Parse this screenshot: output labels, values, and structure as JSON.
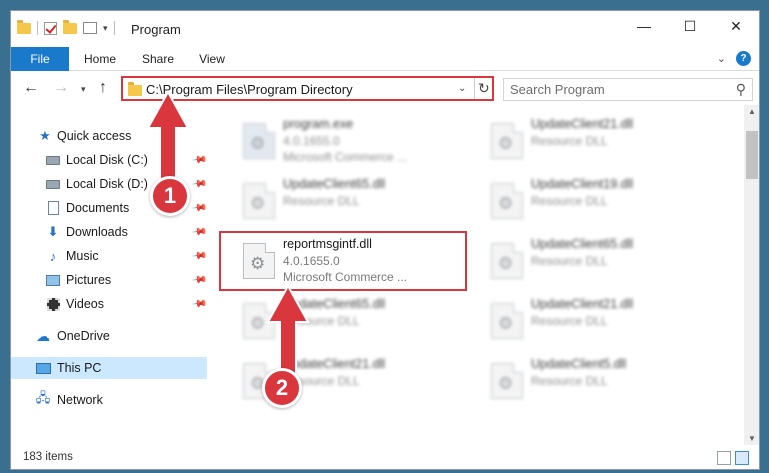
{
  "window": {
    "title": "Program",
    "controls": {
      "minimize": "—",
      "maximize": "☐",
      "close": "✕"
    }
  },
  "ribbon": {
    "tabs": [
      "File",
      "Home",
      "Share",
      "View"
    ],
    "help_label": "?"
  },
  "address": {
    "path": "C:\\Program Files\\Program Directory",
    "search_placeholder": "Search Program"
  },
  "sidebar": {
    "items": [
      {
        "label": "Quick access",
        "icon": "star-icon"
      },
      {
        "label": "Local Disk (C:)",
        "icon": "drive-icon",
        "pinned": true
      },
      {
        "label": "Local Disk (D:)",
        "icon": "drive-icon",
        "pinned": true
      },
      {
        "label": "Documents",
        "icon": "documents-icon",
        "pinned": true
      },
      {
        "label": "Downloads",
        "icon": "downloads-icon",
        "pinned": true
      },
      {
        "label": "Music",
        "icon": "music-icon",
        "pinned": true
      },
      {
        "label": "Pictures",
        "icon": "pictures-icon",
        "pinned": true
      },
      {
        "label": "Videos",
        "icon": "videos-icon",
        "pinned": true
      },
      {
        "label": "OneDrive",
        "icon": "onedrive-icon"
      },
      {
        "label": "This PC",
        "icon": "pc-icon",
        "selected": true
      },
      {
        "label": "Network",
        "icon": "network-icon"
      }
    ]
  },
  "files": {
    "left": [
      {
        "name": "program.exe",
        "line2": "4.0.1655.0",
        "line3": "Microsoft Commerce ...",
        "icon": "exe-icon"
      },
      {
        "name": "UpdateClient65.dll",
        "line2": "Resource DLL",
        "icon": "dll-icon"
      },
      {
        "name": "reportmsgintf.dll",
        "line2": "4.0.1655.0",
        "line3": "Microsoft Commerce ...",
        "icon": "dll-icon",
        "highlighted": true
      },
      {
        "name": "UpdateClient65.dll",
        "line2": "Resource DLL",
        "icon": "dll-icon"
      },
      {
        "name": "UpdateClient21.dll",
        "line2": "Resource DLL",
        "icon": "dll-icon"
      }
    ],
    "right": [
      {
        "name": "UpdateClient21.dll",
        "line2": "Resource DLL",
        "icon": "dll-icon"
      },
      {
        "name": "UpdateClient19.dll",
        "line2": "Resource DLL",
        "icon": "dll-icon"
      },
      {
        "name": "UpdateClient65.dll",
        "line2": "Resource DLL",
        "icon": "dll-icon"
      },
      {
        "name": "UpdateClient21.dll",
        "line2": "Resource DLL",
        "icon": "dll-icon"
      },
      {
        "name": "UpdateClient5.dll",
        "line2": "Resource DLL",
        "icon": "dll-icon"
      }
    ]
  },
  "status": {
    "item_count": "183 items"
  },
  "annotations": {
    "step1": "1",
    "step2": "2",
    "accent_color": "#d9363e"
  }
}
